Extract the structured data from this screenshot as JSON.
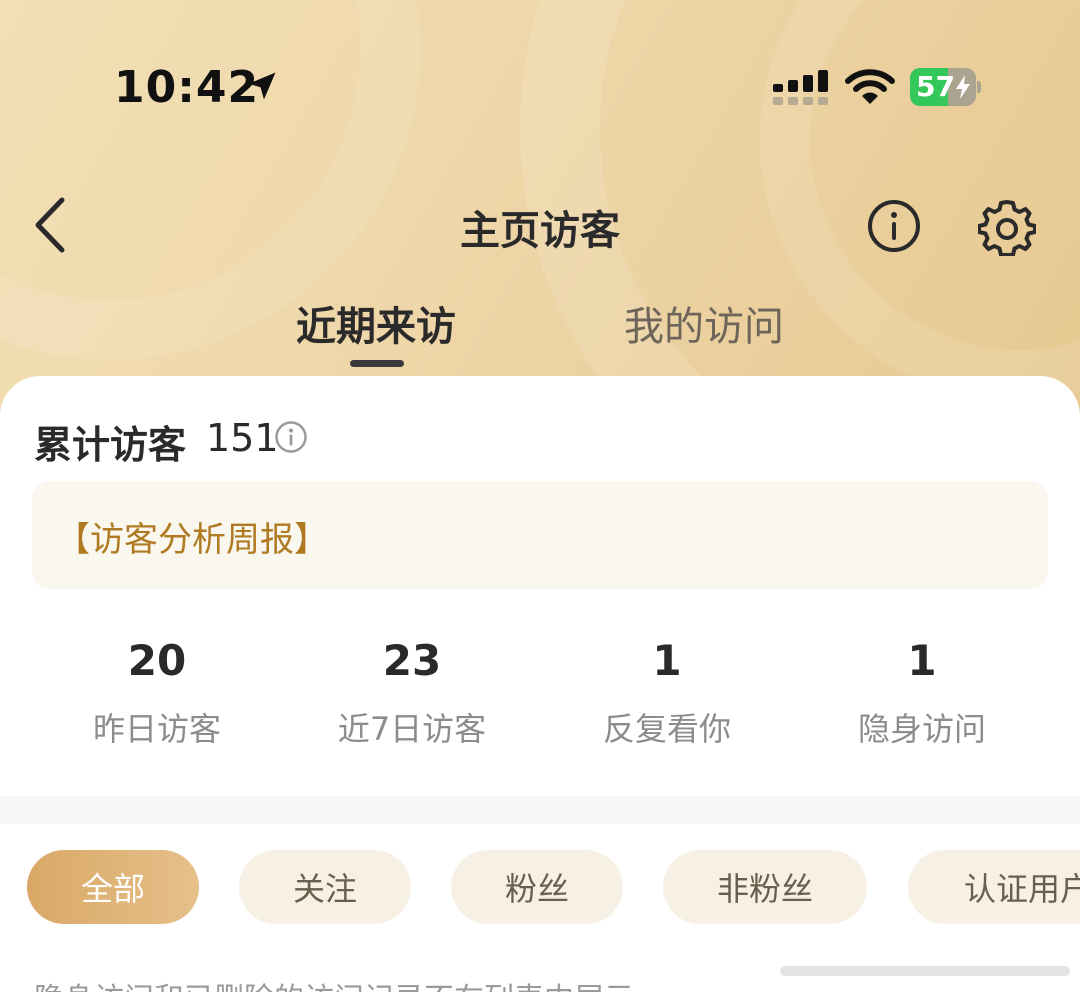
{
  "status_bar": {
    "time": "10:42",
    "battery": "57",
    "battery_level": 0.57,
    "icons": [
      "location-arrow-icon",
      "cellular-signal-icon",
      "wifi-icon",
      "battery-charging-icon"
    ]
  },
  "nav": {
    "title": "主页访客",
    "icons": [
      "back-chevron-icon",
      "info-icon",
      "gear-icon"
    ]
  },
  "tabs": [
    {
      "label": "近期来访",
      "active": true
    },
    {
      "label": "我的访问",
      "active": false
    }
  ],
  "summary": {
    "total_label": "累计访客",
    "total_count": "151",
    "report_text": "【访客分析周报】"
  },
  "stats": [
    {
      "value": "20",
      "label": "昨日访客"
    },
    {
      "value": "23",
      "label": "近7日访客"
    },
    {
      "value": "1",
      "label": "反复看你"
    },
    {
      "value": "1",
      "label": "隐身访问"
    }
  ],
  "filters": [
    {
      "label": "全部",
      "active": true
    },
    {
      "label": "关注",
      "active": false
    },
    {
      "label": "粉丝",
      "active": false
    },
    {
      "label": "非粉丝",
      "active": false
    },
    {
      "label": "认证用户",
      "active": false
    }
  ],
  "note": "隐身访问和已删除的访问记录不在列表中展示",
  "colors": {
    "accent": "#d9a866",
    "report_text": "#b07a22",
    "header_bg": "#eed6a8"
  }
}
